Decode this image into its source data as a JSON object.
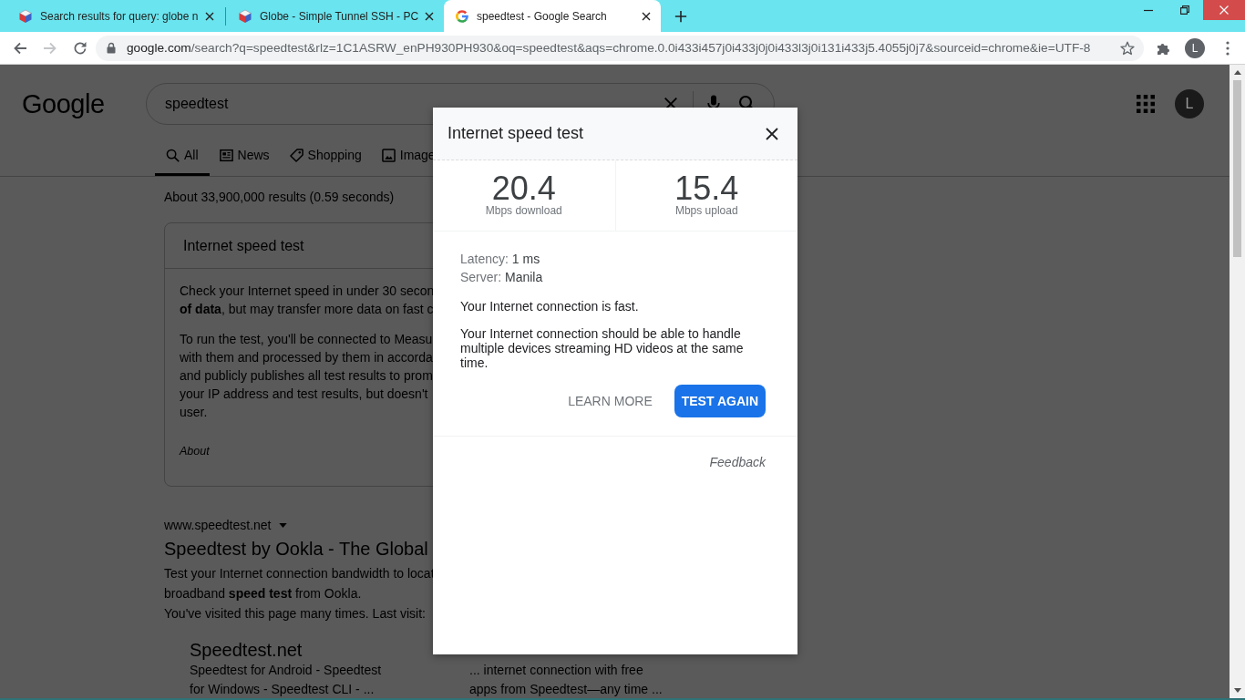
{
  "browser": {
    "tabs": [
      {
        "title": "Search results for query: globe n",
        "kind": "cube",
        "selected": false
      },
      {
        "title": "Globe - Simple Tunnel SSH - PC",
        "kind": "cube",
        "selected": false
      },
      {
        "title": "speedtest - Google Search",
        "kind": "google",
        "selected": true
      }
    ],
    "nav_buttons": [
      {
        "kind": "back",
        "disabled": false
      },
      {
        "kind": "forward",
        "disabled": true
      },
      {
        "kind": "reload",
        "disabled": false
      }
    ],
    "address_bar": {
      "host": "google.com",
      "path": "/search?q=speedtest&rlz=1C1ASRW_enPH930PH930&oq=speedtest&aqs=chrome.0.0i433i457j0i433j0j0i433l3j0i131i433j5.4055j0j7&sourceid=chrome&ie=UTF-8"
    },
    "profile_initial": "L"
  },
  "page": {
    "logo": "Google",
    "search": {
      "value": "speedtest"
    },
    "avatar_initial": "L",
    "nav_tabs": [
      {
        "label": "All",
        "kind": "search",
        "selected": true
      },
      {
        "label": "News",
        "kind": "news",
        "selected": false
      },
      {
        "label": "Shopping",
        "kind": "tag",
        "selected": false
      },
      {
        "label": "Image",
        "kind": "image",
        "selected": false
      }
    ],
    "result_stats": "About 33,900,000 results (0.59 seconds)",
    "speed_card": {
      "title": "Internet speed test",
      "paragraphs": [
        [
          "Check your Internet speed in under 30 secon",
          "**of data**, but may transfer more data on fast c"
        ],
        [
          "To run the test, you'll be connected to Measu",
          "with them and processed by them in accorda",
          "and publicly publishes all test results to prom",
          "your IP address and test results, but doesn't",
          "user."
        ]
      ],
      "about": "About"
    },
    "result": {
      "url": "www.speedtest.net",
      "title": "Speedtest by Ookla - The Global",
      "snippet": [
        "Test your Internet connection bandwidth to locat",
        "broadband **speed test** from Ookla."
      ],
      "visited": "You've visited this page many times. Last visit:",
      "sitelinks": [
        {
          "title": "Speedtest.net",
          "lines": [
            "Speedtest for Android - Speedtest",
            "for Windows - Speedtest CLI - ..."
          ]
        },
        {
          "lines": [
            "... internet connection with free",
            "apps from Speedtest—any time ..."
          ]
        }
      ]
    }
  },
  "dialog": {
    "title": "Internet speed test",
    "results": [
      {
        "value": "20.4",
        "label": "Mbps download"
      },
      {
        "value": "15.4",
        "label": "Mbps upload"
      }
    ],
    "details": [
      {
        "label": "Latency:",
        "value": "1 ms"
      },
      {
        "label": "Server:",
        "value": "Manila"
      }
    ],
    "verdict": "Your Internet connection is fast.",
    "description": "Your Internet connection should be able to handle multiple devices streaming HD videos at the same time.",
    "buttons": [
      {
        "label": "LEARN MORE",
        "kind": "link"
      },
      {
        "label": "TEST AGAIN",
        "kind": "button"
      }
    ],
    "feedback": "Feedback"
  }
}
